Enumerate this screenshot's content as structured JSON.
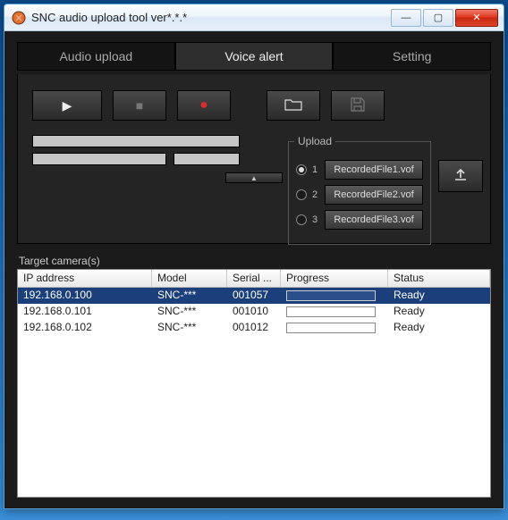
{
  "window": {
    "title": "SNC audio upload tool ver*.*.*"
  },
  "tabs": {
    "items": [
      {
        "label": "Audio upload"
      },
      {
        "label": "Voice alert"
      },
      {
        "label": "Setting"
      }
    ],
    "active_index": 1
  },
  "upload_group": {
    "legend": "Upload",
    "selected_index": 0,
    "items": [
      {
        "num": "1",
        "label": "RecordedFile1.vof"
      },
      {
        "num": "2",
        "label": "RecordedFile2.vof"
      },
      {
        "num": "3",
        "label": "RecordedFile3.vof"
      }
    ]
  },
  "target": {
    "label": "Target camera(s)",
    "columns": {
      "ip": "IP address",
      "model": "Model",
      "serial": "Serial ...",
      "progress": "Progress",
      "status": "Status"
    },
    "rows": [
      {
        "ip": "192.168.0.100",
        "model": "SNC-***",
        "serial": "001057",
        "status": "Ready",
        "selected": true
      },
      {
        "ip": "192.168.0.101",
        "model": "SNC-***",
        "serial": "001010",
        "status": "Ready",
        "selected": false
      },
      {
        "ip": "192.168.0.102",
        "model": "SNC-***",
        "serial": "001012",
        "status": "Ready",
        "selected": false
      }
    ]
  },
  "icons": {
    "play": "▶",
    "stop": "■",
    "record": "●",
    "folder": "🗀",
    "save": "💾",
    "upload": "⬆",
    "collapse": "▲",
    "min": "—",
    "max": "▢",
    "close": "✕"
  }
}
